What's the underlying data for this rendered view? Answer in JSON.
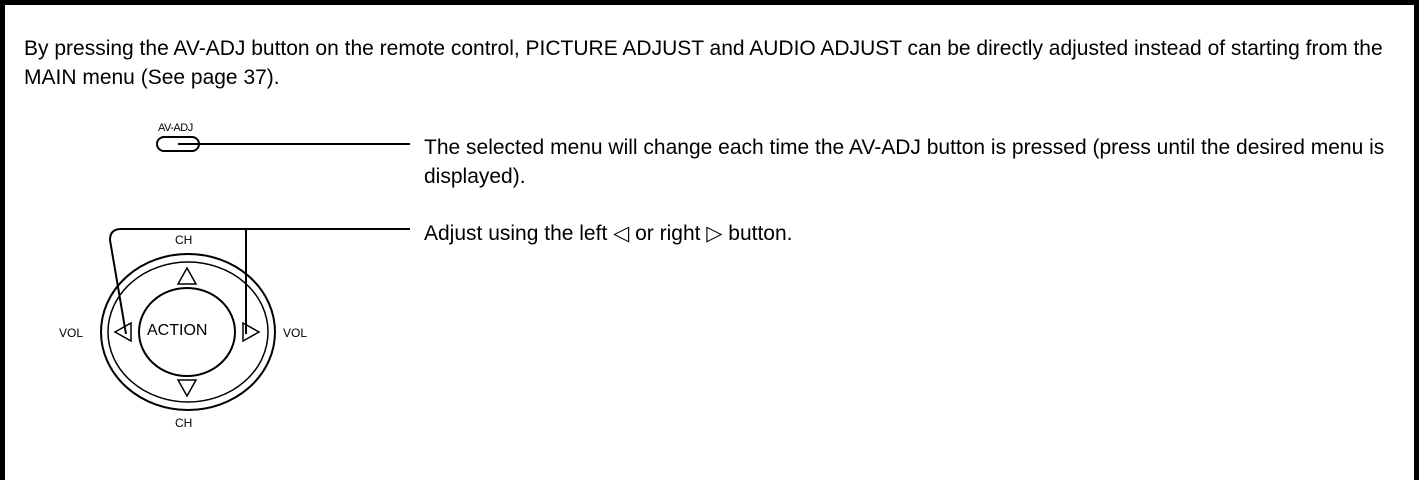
{
  "intro": {
    "text": "By pressing the AV-ADJ button on the remote control, PICTURE ADJUST and AUDIO ADJUST can be directly adjusted instead of starting from the MAIN menu (See page 37)."
  },
  "diagram": {
    "av_adj_label": "AV-ADJ",
    "ch_top_label": "CH",
    "ch_bottom_label": "CH",
    "vol_left_label": "VOL",
    "vol_right_label": "VOL",
    "action_label": "ACTION",
    "icons": [
      "av-adj-button-icon",
      "up-triangle-icon",
      "down-triangle-icon",
      "left-triangle-icon",
      "right-triangle-icon"
    ]
  },
  "instructions": [
    {
      "text": "The selected menu will change each time the AV-ADJ button is pressed (press until the desired menu is displayed)."
    },
    {
      "text": "Adjust using the left ◁ or right ▷ button."
    }
  ]
}
